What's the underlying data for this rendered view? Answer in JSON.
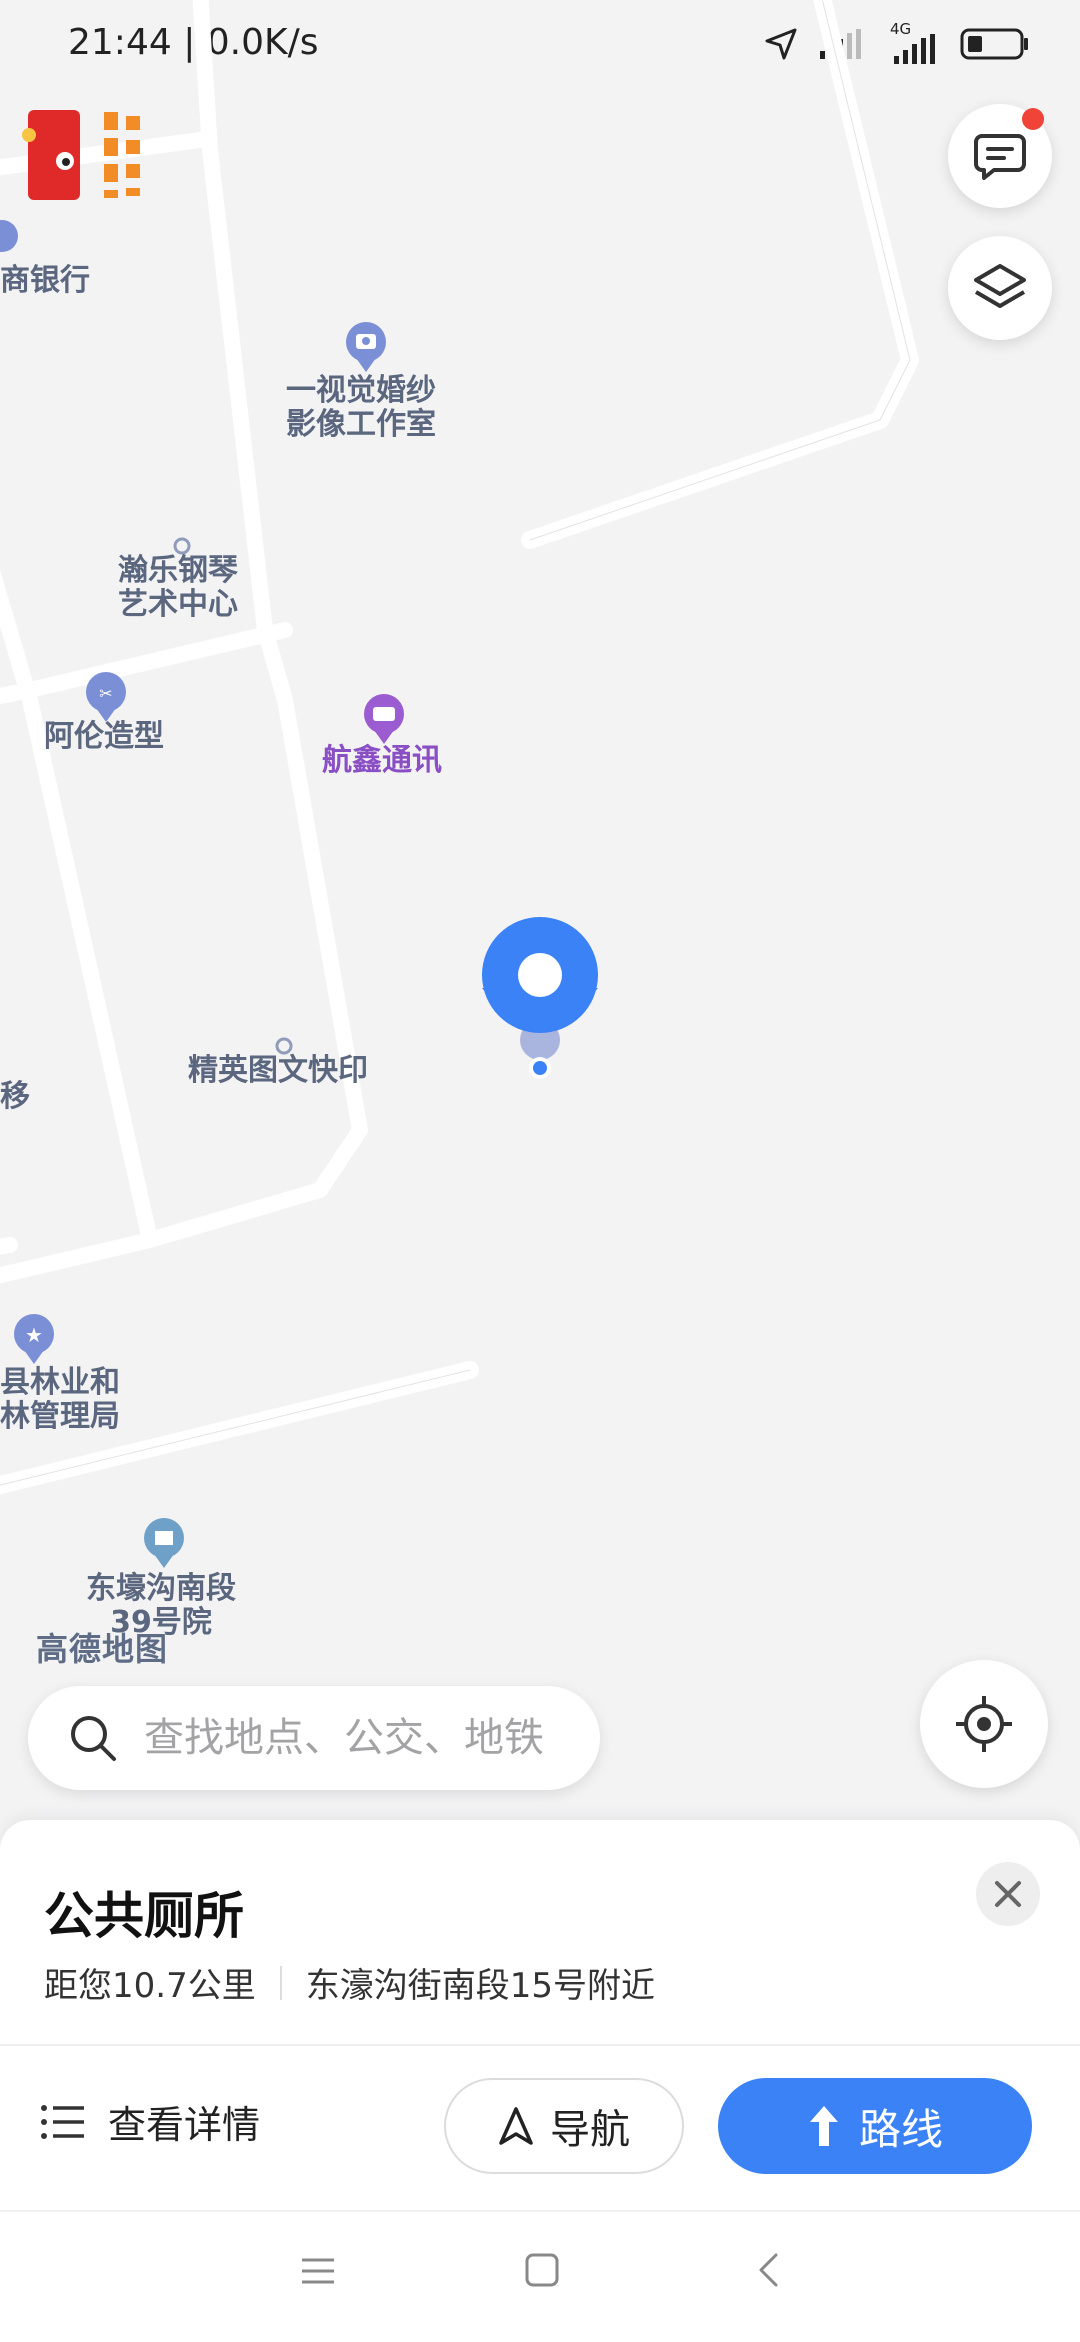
{
  "status": {
    "time": "21:44 | 0.0K/s",
    "network": "4G"
  },
  "map": {
    "labels": {
      "bank": "商银行",
      "wedding": "一视觉婚纱\n影像工作室",
      "piano": "瀚乐钢琴\n艺术中心",
      "hair": "阿伦造型",
      "telecom": "航鑫通讯",
      "print": "精英图文快印",
      "edge": "移",
      "forestry": "县林业和\n林管理局",
      "courtyard": "东壕沟南段\n39号院"
    },
    "watermark": "高德地图"
  },
  "search": {
    "placeholder": "查找地点、公交、地铁"
  },
  "place": {
    "name": "公共厕所",
    "distance": "距您10.7公里",
    "address": "东濠沟街南段15号附近"
  },
  "actions": {
    "details": "查看详情",
    "navigate": "导航",
    "route": "路线"
  },
  "colors": {
    "accent": "#3b82f6",
    "poi": "#7a8fd6",
    "poi_purple": "#9b5bd1"
  }
}
